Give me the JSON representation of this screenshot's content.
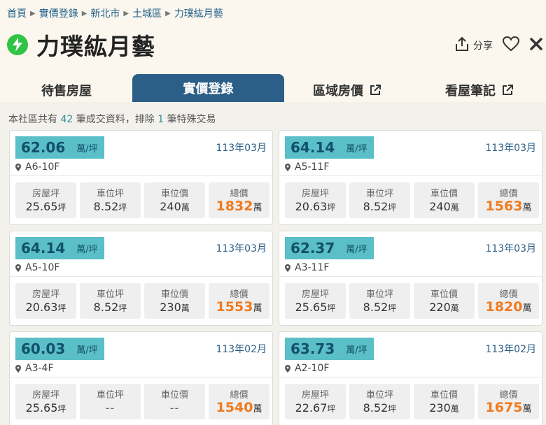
{
  "breadcrumb": [
    "首頁",
    "實價登錄",
    "新北市",
    "土城區",
    "力璞紘月藝"
  ],
  "page_title": "力璞紘月藝",
  "actions": {
    "share_label": "分享"
  },
  "tabs": [
    {
      "label": "待售房屋",
      "external": false
    },
    {
      "label": "實價登錄",
      "external": false,
      "active": true
    },
    {
      "label": "區域房價",
      "external": true
    },
    {
      "label": "看屋筆記",
      "external": true
    }
  ],
  "summary": {
    "prefix": "本社區共有",
    "count": "42",
    "mid": "筆成交資料，排除",
    "excluded": "1",
    "suffix": "筆特殊交易"
  },
  "labels": {
    "unit_price": "萬/坪",
    "area": "房屋坪",
    "parking_area": "車位坪",
    "parking_price": "車位價",
    "total": "總價",
    "ping": "坪",
    "wan": "萬"
  },
  "colors": {
    "accent": "#2c5f87",
    "badge": "#5bbfc8",
    "total": "#f07a1e",
    "bolt": "#2fc445"
  },
  "records": [
    {
      "unit_price": "62.06",
      "date": "113年03月",
      "unit": "A6-10F",
      "area": "25.65",
      "parking_area": "8.52",
      "parking_price": "240",
      "total": "1832"
    },
    {
      "unit_price": "64.14",
      "date": "113年03月",
      "unit": "A5-11F",
      "area": "20.63",
      "parking_area": "8.52",
      "parking_price": "240",
      "total": "1563"
    },
    {
      "unit_price": "64.14",
      "date": "113年03月",
      "unit": "A5-10F",
      "area": "20.63",
      "parking_area": "8.52",
      "parking_price": "230",
      "total": "1553"
    },
    {
      "unit_price": "62.37",
      "date": "113年03月",
      "unit": "A3-11F",
      "area": "25.65",
      "parking_area": "8.52",
      "parking_price": "220",
      "total": "1820"
    },
    {
      "unit_price": "60.03",
      "date": "113年02月",
      "unit": "A3-4F",
      "area": "25.65",
      "parking_area": "--",
      "parking_price": "--",
      "total": "1540"
    },
    {
      "unit_price": "63.73",
      "date": "113年02月",
      "unit": "A2-10F",
      "area": "22.67",
      "parking_area": "8.52",
      "parking_price": "230",
      "total": "1675"
    }
  ]
}
